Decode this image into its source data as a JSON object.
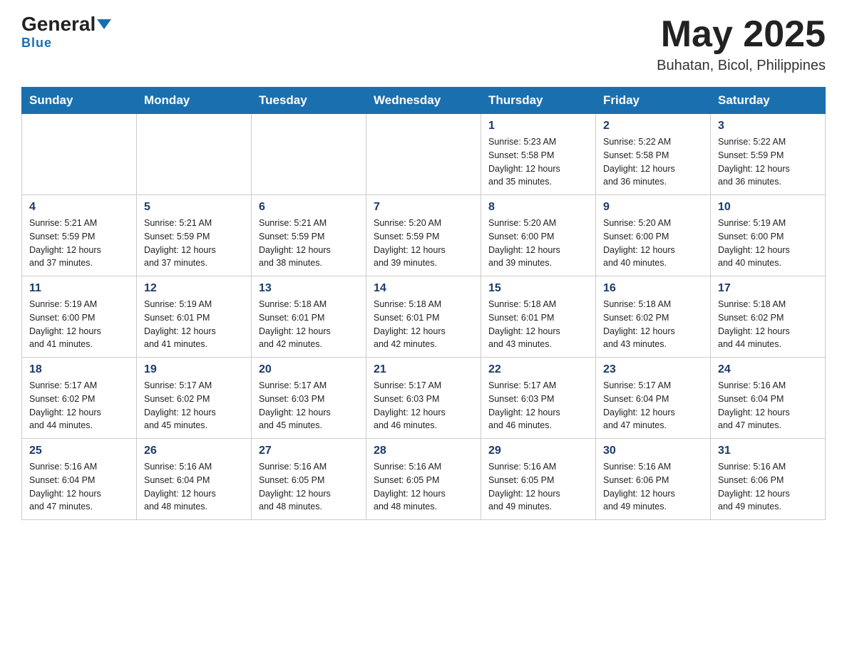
{
  "header": {
    "logo_general": "General",
    "logo_blue": "Blue",
    "month_title": "May 2025",
    "location": "Buhatan, Bicol, Philippines"
  },
  "days_of_week": [
    "Sunday",
    "Monday",
    "Tuesday",
    "Wednesday",
    "Thursday",
    "Friday",
    "Saturday"
  ],
  "weeks": [
    {
      "days": [
        {
          "number": "",
          "info": ""
        },
        {
          "number": "",
          "info": ""
        },
        {
          "number": "",
          "info": ""
        },
        {
          "number": "",
          "info": ""
        },
        {
          "number": "1",
          "info": "Sunrise: 5:23 AM\nSunset: 5:58 PM\nDaylight: 12 hours\nand 35 minutes."
        },
        {
          "number": "2",
          "info": "Sunrise: 5:22 AM\nSunset: 5:58 PM\nDaylight: 12 hours\nand 36 minutes."
        },
        {
          "number": "3",
          "info": "Sunrise: 5:22 AM\nSunset: 5:59 PM\nDaylight: 12 hours\nand 36 minutes."
        }
      ]
    },
    {
      "days": [
        {
          "number": "4",
          "info": "Sunrise: 5:21 AM\nSunset: 5:59 PM\nDaylight: 12 hours\nand 37 minutes."
        },
        {
          "number": "5",
          "info": "Sunrise: 5:21 AM\nSunset: 5:59 PM\nDaylight: 12 hours\nand 37 minutes."
        },
        {
          "number": "6",
          "info": "Sunrise: 5:21 AM\nSunset: 5:59 PM\nDaylight: 12 hours\nand 38 minutes."
        },
        {
          "number": "7",
          "info": "Sunrise: 5:20 AM\nSunset: 5:59 PM\nDaylight: 12 hours\nand 39 minutes."
        },
        {
          "number": "8",
          "info": "Sunrise: 5:20 AM\nSunset: 6:00 PM\nDaylight: 12 hours\nand 39 minutes."
        },
        {
          "number": "9",
          "info": "Sunrise: 5:20 AM\nSunset: 6:00 PM\nDaylight: 12 hours\nand 40 minutes."
        },
        {
          "number": "10",
          "info": "Sunrise: 5:19 AM\nSunset: 6:00 PM\nDaylight: 12 hours\nand 40 minutes."
        }
      ]
    },
    {
      "days": [
        {
          "number": "11",
          "info": "Sunrise: 5:19 AM\nSunset: 6:00 PM\nDaylight: 12 hours\nand 41 minutes."
        },
        {
          "number": "12",
          "info": "Sunrise: 5:19 AM\nSunset: 6:01 PM\nDaylight: 12 hours\nand 41 minutes."
        },
        {
          "number": "13",
          "info": "Sunrise: 5:18 AM\nSunset: 6:01 PM\nDaylight: 12 hours\nand 42 minutes."
        },
        {
          "number": "14",
          "info": "Sunrise: 5:18 AM\nSunset: 6:01 PM\nDaylight: 12 hours\nand 42 minutes."
        },
        {
          "number": "15",
          "info": "Sunrise: 5:18 AM\nSunset: 6:01 PM\nDaylight: 12 hours\nand 43 minutes."
        },
        {
          "number": "16",
          "info": "Sunrise: 5:18 AM\nSunset: 6:02 PM\nDaylight: 12 hours\nand 43 minutes."
        },
        {
          "number": "17",
          "info": "Sunrise: 5:18 AM\nSunset: 6:02 PM\nDaylight: 12 hours\nand 44 minutes."
        }
      ]
    },
    {
      "days": [
        {
          "number": "18",
          "info": "Sunrise: 5:17 AM\nSunset: 6:02 PM\nDaylight: 12 hours\nand 44 minutes."
        },
        {
          "number": "19",
          "info": "Sunrise: 5:17 AM\nSunset: 6:02 PM\nDaylight: 12 hours\nand 45 minutes."
        },
        {
          "number": "20",
          "info": "Sunrise: 5:17 AM\nSunset: 6:03 PM\nDaylight: 12 hours\nand 45 minutes."
        },
        {
          "number": "21",
          "info": "Sunrise: 5:17 AM\nSunset: 6:03 PM\nDaylight: 12 hours\nand 46 minutes."
        },
        {
          "number": "22",
          "info": "Sunrise: 5:17 AM\nSunset: 6:03 PM\nDaylight: 12 hours\nand 46 minutes."
        },
        {
          "number": "23",
          "info": "Sunrise: 5:17 AM\nSunset: 6:04 PM\nDaylight: 12 hours\nand 47 minutes."
        },
        {
          "number": "24",
          "info": "Sunrise: 5:16 AM\nSunset: 6:04 PM\nDaylight: 12 hours\nand 47 minutes."
        }
      ]
    },
    {
      "days": [
        {
          "number": "25",
          "info": "Sunrise: 5:16 AM\nSunset: 6:04 PM\nDaylight: 12 hours\nand 47 minutes."
        },
        {
          "number": "26",
          "info": "Sunrise: 5:16 AM\nSunset: 6:04 PM\nDaylight: 12 hours\nand 48 minutes."
        },
        {
          "number": "27",
          "info": "Sunrise: 5:16 AM\nSunset: 6:05 PM\nDaylight: 12 hours\nand 48 minutes."
        },
        {
          "number": "28",
          "info": "Sunrise: 5:16 AM\nSunset: 6:05 PM\nDaylight: 12 hours\nand 48 minutes."
        },
        {
          "number": "29",
          "info": "Sunrise: 5:16 AM\nSunset: 6:05 PM\nDaylight: 12 hours\nand 49 minutes."
        },
        {
          "number": "30",
          "info": "Sunrise: 5:16 AM\nSunset: 6:06 PM\nDaylight: 12 hours\nand 49 minutes."
        },
        {
          "number": "31",
          "info": "Sunrise: 5:16 AM\nSunset: 6:06 PM\nDaylight: 12 hours\nand 49 minutes."
        }
      ]
    }
  ]
}
